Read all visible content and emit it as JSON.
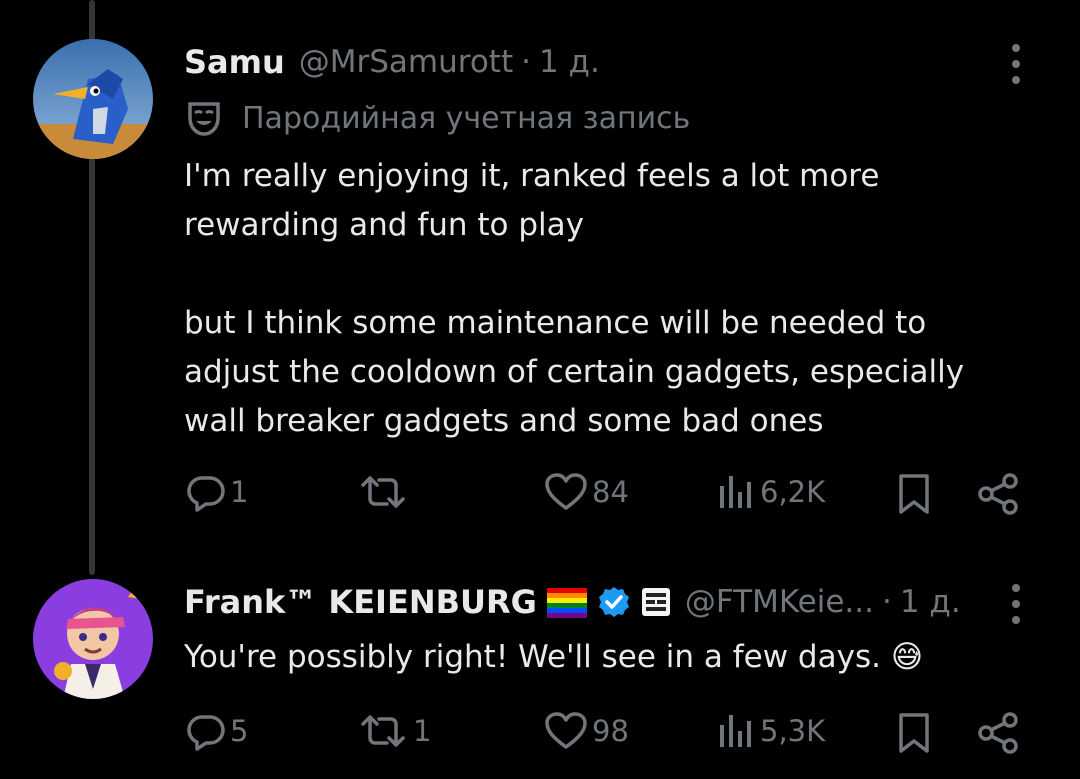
{
  "tweets": [
    {
      "name": "Samu",
      "handle": "@MrSamurott",
      "separator": "·",
      "time": "1 д.",
      "parody_label": "Пародийная учетная запись",
      "text_lines": [
        "I'm really enjoying it, ranked feels a lot more",
        "rewarding and fun to play",
        "but I think some maintenance will be needed to",
        "adjust the cooldown of certain gadgets, especially",
        "wall breaker gadgets and some bad ones"
      ],
      "replies": "1",
      "reposts": "",
      "likes": "84",
      "views": "6,2K"
    },
    {
      "name": "Frank™ KEIENBURG",
      "handle": "@FTMKeie...",
      "separator": "·",
      "time": "1 д.",
      "text": "You're possibly right! We'll see in a few days.",
      "emoji": "😅",
      "replies": "5",
      "reposts": "1",
      "likes": "98",
      "views": "5,3K"
    }
  ],
  "icons": {
    "reply": "reply-icon",
    "repost": "repost-icon",
    "like": "heart-icon",
    "views": "views-icon",
    "bookmark": "bookmark-icon",
    "share": "share-icon",
    "more": "more-vertical-icon",
    "parody": "theater-mask-icon",
    "verified": "verified-badge-icon",
    "flag": "rainbow-flag-icon",
    "affiliate": "affiliate-badge-icon"
  },
  "colors": {
    "background": "#000000",
    "text": "#e7e9ea",
    "muted": "#71767b",
    "verified": "#1d9bf0"
  }
}
